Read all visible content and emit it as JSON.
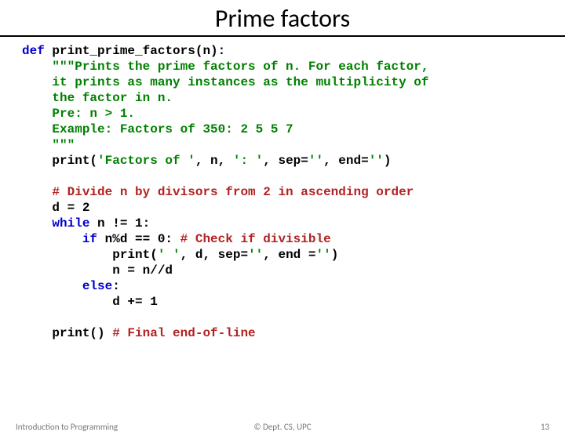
{
  "title": "Prime factors",
  "code": {
    "l1a": "def",
    "l1b": " print_prime_factors(n):",
    "l2a": "    ",
    "l2b": "\"\"\"Prints the prime factors of n. For each factor,",
    "l3": "    it prints as many instances as the multiplicity of",
    "l4": "    the factor in n.",
    "l5": "    Pre: n > 1.",
    "l6": "    Example: Factors of 350: 2 5 5 7",
    "l7": "    \"\"\"",
    "l8a": "    print(",
    "l8b": "'Factors of '",
    "l8c": ", n, ",
    "l8d": "': '",
    "l8e": ", sep=",
    "l8f": "''",
    "l8g": ", end=",
    "l8h": "''",
    "l8i": ")",
    "blank1": "",
    "l9a": "    ",
    "l9b": "# Divide n by divisors from 2 in ascending order",
    "l10": "    d = 2",
    "l11a": "    ",
    "l11b": "while",
    "l11c": " n != 1:",
    "l12a": "        ",
    "l12b": "if",
    "l12c": " n%d == 0: ",
    "l12d": "# Check if divisible",
    "l13a": "            print(",
    "l13b": "' '",
    "l13c": ", d, sep=",
    "l13d": "''",
    "l13e": ", end =",
    "l13f": "''",
    "l13g": ")",
    "l14": "            n = n//d",
    "l15a": "        ",
    "l15b": "else",
    "l15c": ":",
    "l16": "            d += 1",
    "blank2": "",
    "l17a": "    print() ",
    "l17b": "# Final end-of-line"
  },
  "footer": {
    "left": "Introduction to Programming",
    "center": "© Dept. CS, UPC",
    "right": "13"
  }
}
